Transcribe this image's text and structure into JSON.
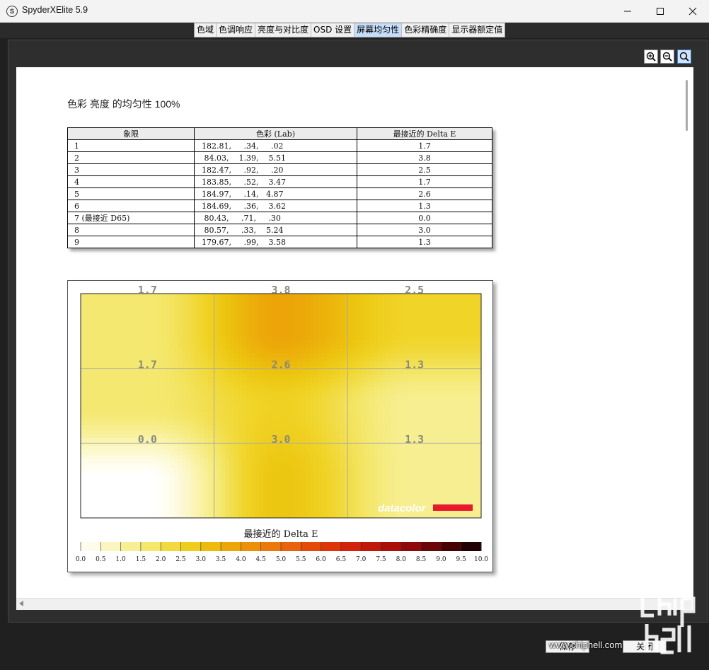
{
  "window": {
    "title": "SpyderXElite 5.9"
  },
  "tabs": [
    {
      "label": "色域"
    },
    {
      "label": "色调响应"
    },
    {
      "label": "亮度与对比度"
    },
    {
      "label": "OSD 设置"
    },
    {
      "label": "屏幕均匀性",
      "active": true
    },
    {
      "label": "色彩精确度"
    },
    {
      "label": "显示器额定值"
    }
  ],
  "report": {
    "title": "色彩 亮度 的均匀性 100%",
    "table": {
      "headers": [
        "象限",
        "色彩 (Lab)",
        "最接近的 Delta E"
      ],
      "rows": [
        [
          "1",
          "182.81,     .34,     .02",
          "1.7"
        ],
        [
          "2",
          " 84.03,    1.39,    5.51",
          "3.8"
        ],
        [
          "3",
          "182.47,     .92,     .20",
          "2.5"
        ],
        [
          "4",
          "183.85,     .52,    3.47",
          "1.7"
        ],
        [
          "5",
          "184.97,     .14,   4.87",
          "2.6"
        ],
        [
          "6",
          "184.69,     .36,    3.62",
          "1.3"
        ],
        [
          "7 (最接近 D65)",
          " 80.43,     .71,     .30",
          "0.0"
        ],
        [
          "8",
          " 80.57,     .33,    5.24",
          "3.0"
        ],
        [
          "9",
          "179.67,     .99,    3.58",
          "1.3"
        ]
      ]
    }
  },
  "chart_data": {
    "type": "heatmap",
    "grid_rows": 3,
    "grid_cols": 3,
    "cells": [
      [
        1.7,
        3.8,
        2.5
      ],
      [
        1.7,
        2.6,
        1.3
      ],
      [
        0.0,
        3.0,
        1.3
      ]
    ],
    "cell_labels": [
      [
        "1.7",
        "3.8",
        "2.5"
      ],
      [
        "1.7",
        "2.6",
        "1.3"
      ],
      [
        "0.0",
        "3.0",
        "1.3"
      ]
    ],
    "colorbar_title": "最接近的 Delta E",
    "colorbar_range": [
      0,
      10
    ],
    "colorbar_ticks": [
      "0.0",
      "0.5",
      "1.0",
      "1.5",
      "2.0",
      "2.5",
      "3.0",
      "3.5",
      "4.0",
      "4.5",
      "5.0",
      "5.5",
      "6.0",
      "6.5",
      "7.0",
      "7.5",
      "8.0",
      "8.5",
      "9.0",
      "9.5",
      "10.0"
    ],
    "brand": "datacolor",
    "grid": true
  },
  "buttons": {
    "save": "保存",
    "close": "关闭"
  },
  "watermark": "www.chiphell.com",
  "colors": {
    "accent": "#c6defa",
    "brand_red": "#e8192c"
  }
}
